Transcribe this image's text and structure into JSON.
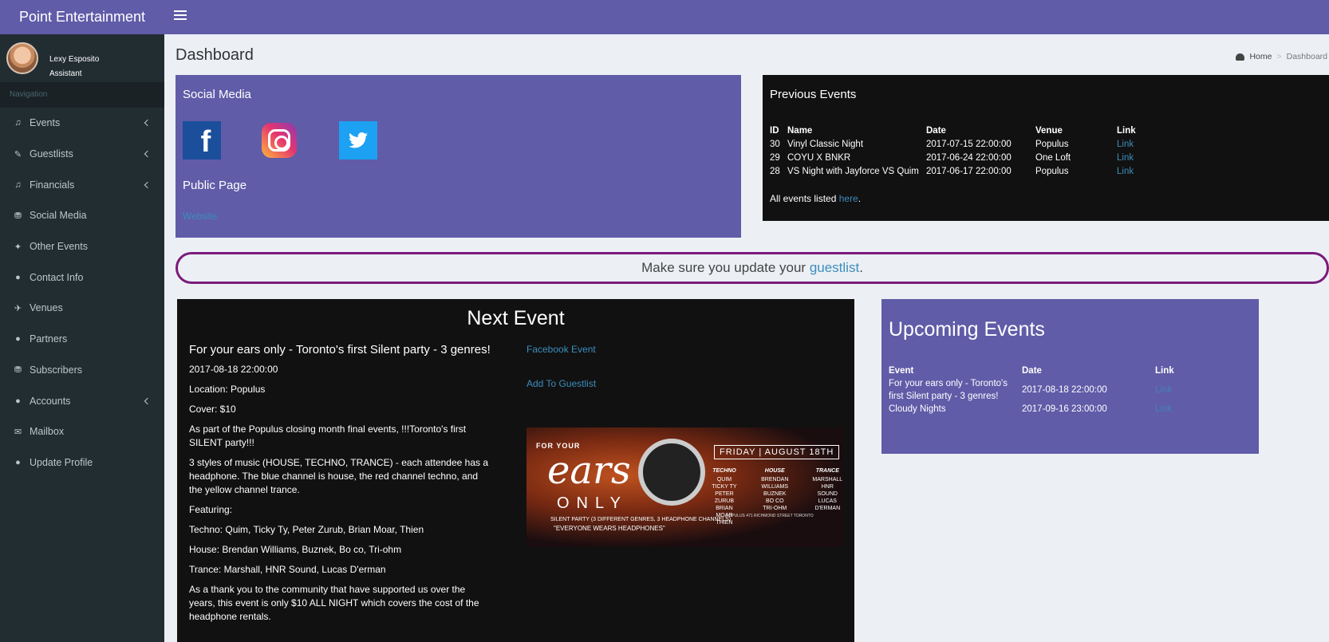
{
  "app": {
    "title": "Point Entertainment"
  },
  "user": {
    "name": "Lexy Esposito",
    "role": "Assistant"
  },
  "sidebar": {
    "header": "Navigation",
    "items": [
      {
        "label": "Events",
        "icon": "music-icon",
        "glyph": "♫",
        "has_submenu": true
      },
      {
        "label": "Guestlists",
        "icon": "pencil-icon",
        "glyph": "✎",
        "has_submenu": true
      },
      {
        "label": "Financials",
        "icon": "music-icon",
        "glyph": "♫",
        "has_submenu": true
      },
      {
        "label": "Social Media",
        "icon": "binoculars-icon",
        "glyph": "⛃",
        "has_submenu": false
      },
      {
        "label": "Other Events",
        "icon": "ticket-icon",
        "glyph": "✦",
        "has_submenu": false
      },
      {
        "label": "Contact Info",
        "icon": "user-icon",
        "glyph": "●",
        "has_submenu": false
      },
      {
        "label": "Venues",
        "icon": "plane-icon",
        "glyph": "✈",
        "has_submenu": false
      },
      {
        "label": "Partners",
        "icon": "users-icon",
        "glyph": "●",
        "has_submenu": false
      },
      {
        "label": "Subscribers",
        "icon": "binoculars-icon",
        "glyph": "⛃",
        "has_submenu": false
      },
      {
        "label": "Accounts",
        "icon": "user-icon",
        "glyph": "●",
        "has_submenu": true
      },
      {
        "label": "Mailbox",
        "icon": "envelope-icon",
        "glyph": "✉",
        "has_submenu": false
      },
      {
        "label": "Update Profile",
        "icon": "user-icon",
        "glyph": "●",
        "has_submenu": false
      }
    ]
  },
  "page": {
    "title": "Dashboard"
  },
  "breadcrumb": {
    "home": "Home",
    "current": "Dashboard"
  },
  "social": {
    "heading": "Social Media",
    "public_heading": "Public Page",
    "website_label": "Website"
  },
  "previous_events": {
    "heading": "Previous Events",
    "columns": [
      "ID",
      "Name",
      "Date",
      "Venue",
      "Link"
    ],
    "rows": [
      {
        "id": "30",
        "name": "Vinyl Classic Night",
        "date": "2017-07-15 22:00:00",
        "venue": "Populus",
        "link": "Link"
      },
      {
        "id": "29",
        "name": "COYU X BNKR",
        "date": "2017-06-24 22:00:00",
        "venue": "One Loft",
        "link": "Link"
      },
      {
        "id": "28",
        "name": "VS Night with Jayforce VS Quim",
        "date": "2017-06-17 22:00:00",
        "venue": "Populus",
        "link": "Link"
      }
    ],
    "all_prefix": "All events listed ",
    "all_link": "here",
    "all_suffix": "."
  },
  "notice": {
    "prefix": "Make sure you update your ",
    "link": "guestlist",
    "suffix": "."
  },
  "next_event": {
    "heading": "Next Event",
    "name": "For your ears only - Toronto's first Silent party - 3 genres!",
    "date": "2017-08-18 22:00:00",
    "location": "Location: Populus",
    "cover": "Cover: $10",
    "paragraphs": [
      "As part of the Populus closing month final events, !!!Toronto's first SILENT party!!!",
      "3 styles of music (HOUSE, TECHNO, TRANCE) - each attendee has a headphone. The blue channel is house, the red channel techno, and the yellow channel trance.",
      "Featuring:",
      "Techno: Quim, Ticky Ty, Peter Zurub, Brian Moar, Thien",
      "House: Brendan Williams, Buznek, Bo co, Tri-ohm",
      "Trance: Marshall, HNR Sound, Lucas D'erman",
      "As a thank you to the community that have supported us over the years, this event is only $10 ALL NIGHT which covers the cost of the headphone rentals."
    ],
    "facebook_label": "Facebook Event",
    "guestlist_label": "Add To Guestlist",
    "poster": {
      "for_your": "FOR YOUR",
      "ears": "ears",
      "only": "ONLY",
      "tagline": "SILENT PARTY (3 DIFFERENT GENRES, 3 HEADPHONE CHANNELS)",
      "slogan": "\"EVERYONE WEARS HEADPHONES\"",
      "date": "FRIDAY | AUGUST 18TH",
      "techno_h": "TECHNO",
      "techno": "QUIM\nTICKY TY\nPETER ZURUB\nBRIAN MOAR\nTHIEN",
      "house_h": "HOUSE",
      "house": "BRENDAN WILLIAMS\nBUZNEK\nBO CO\nTRI-OHM",
      "trance_h": "TRANCE",
      "trance": "MARSHALL\nHNR SOUND\nLUCAS D'ERMAN",
      "venue": "POPULUS 471 RICHMOND STREET TORONTO"
    }
  },
  "upcoming_events": {
    "heading": "Upcoming Events",
    "columns": [
      "Event",
      "Date",
      "Link"
    ],
    "rows": [
      {
        "event": "For your ears only - Toronto's first Silent party - 3 genres!",
        "date": "2017-08-18 22:00:00",
        "link": "Link"
      },
      {
        "event": "Cloudy Nights",
        "date": "2017-09-16 23:00:00",
        "link": "Link"
      }
    ]
  },
  "colors": {
    "brand": "#605ca8",
    "sidebar": "#222d32",
    "link": "#3c8dbc",
    "notice_border": "#7b1a7b"
  }
}
